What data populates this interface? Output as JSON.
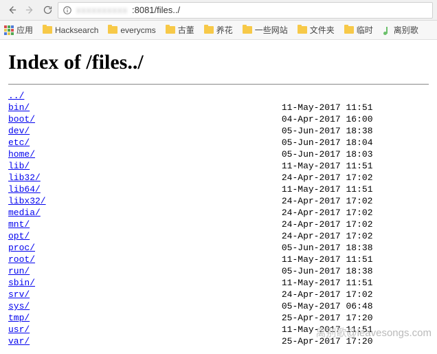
{
  "browser": {
    "url_blurred_host": "xxxxxxxxxx",
    "url_rest": ":8081/files../"
  },
  "bookmarks": {
    "apps_label": "应用",
    "items": [
      {
        "label": "Hacksearch"
      },
      {
        "label": "everycms"
      },
      {
        "label": "古董"
      },
      {
        "label": "养花"
      },
      {
        "label": "一些网站"
      },
      {
        "label": "文件夹"
      },
      {
        "label": "临时"
      }
    ],
    "special": {
      "label": "离别歌"
    }
  },
  "page": {
    "heading_prefix": "Index of ",
    "heading_path": "/files../",
    "parent_link": "../",
    "entries": [
      {
        "name": "bin/",
        "date": "11-May-2017 11:51",
        "size": "-"
      },
      {
        "name": "boot/",
        "date": "04-Apr-2017 16:00",
        "size": "-"
      },
      {
        "name": "dev/",
        "date": "05-Jun-2017 18:38",
        "size": "-"
      },
      {
        "name": "etc/",
        "date": "05-Jun-2017 18:04",
        "size": "-"
      },
      {
        "name": "home/",
        "date": "05-Jun-2017 18:03",
        "size": "-"
      },
      {
        "name": "lib/",
        "date": "11-May-2017 11:51",
        "size": "-"
      },
      {
        "name": "lib32/",
        "date": "24-Apr-2017 17:02",
        "size": "-"
      },
      {
        "name": "lib64/",
        "date": "11-May-2017 11:51",
        "size": "-"
      },
      {
        "name": "libx32/",
        "date": "24-Apr-2017 17:02",
        "size": "-"
      },
      {
        "name": "media/",
        "date": "24-Apr-2017 17:02",
        "size": "-"
      },
      {
        "name": "mnt/",
        "date": "24-Apr-2017 17:02",
        "size": "-"
      },
      {
        "name": "opt/",
        "date": "24-Apr-2017 17:02",
        "size": "-"
      },
      {
        "name": "proc/",
        "date": "05-Jun-2017 18:38",
        "size": "-"
      },
      {
        "name": "root/",
        "date": "11-May-2017 11:51",
        "size": "-"
      },
      {
        "name": "run/",
        "date": "05-Jun-2017 18:38",
        "size": "-"
      },
      {
        "name": "sbin/",
        "date": "11-May-2017 11:51",
        "size": "-"
      },
      {
        "name": "srv/",
        "date": "24-Apr-2017 17:02",
        "size": "-"
      },
      {
        "name": "sys/",
        "date": "05-May-2017 06:48",
        "size": "-"
      },
      {
        "name": "tmp/",
        "date": "25-Apr-2017 17:20",
        "size": "-"
      },
      {
        "name": "usr/",
        "date": "11-May-2017 11:51",
        "size": "-"
      },
      {
        "name": "var/",
        "date": "25-Apr-2017 17:20",
        "size": "-"
      }
    ]
  },
  "watermark": {
    "cn": "离别歌",
    "en": "@leavesongs.com"
  }
}
